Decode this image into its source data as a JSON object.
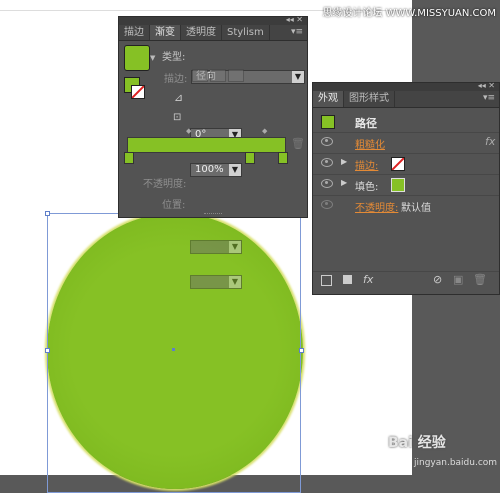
{
  "watermark": {
    "top": "思缘设计论坛 WWW.MISSYUAN.COM",
    "bottom": "Bai 经验",
    "bottom_url": "jingyan.baidu.com"
  },
  "gradient_panel": {
    "tabs": [
      "描边",
      "渐变",
      "透明度",
      "Stylism"
    ],
    "active_tab": "渐变",
    "type_label": "类型:",
    "type_value": "径向",
    "stroke_label": "描边:",
    "angle_value": "0°",
    "aspect_value": "100%",
    "opacity_label": "不透明度:",
    "position_label": "位置:",
    "fill_color": "#86c125",
    "ramp_color": "#86c125"
  },
  "appearance_panel": {
    "tabs": [
      "外观",
      "图形样式"
    ],
    "title": "路径",
    "rows": [
      {
        "label": "粗糙化",
        "value": "",
        "fx": "fx"
      },
      {
        "label": "描边:",
        "value": ""
      },
      {
        "label": "填色:",
        "value": ""
      },
      {
        "label": "不透明度:",
        "value": "默认值"
      }
    ],
    "footer_fx": "fx"
  }
}
